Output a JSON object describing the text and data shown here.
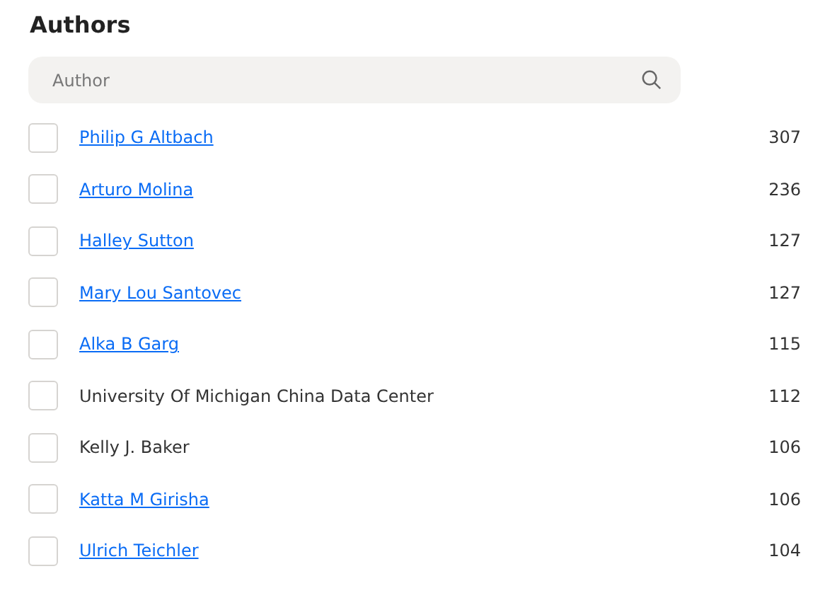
{
  "title": "Authors",
  "search": {
    "placeholder": "Author"
  },
  "authors": [
    {
      "name": "Philip G Altbach",
      "kind": "link",
      "count": "307",
      "checked": false
    },
    {
      "name": "Arturo Molina",
      "kind": "link",
      "count": "236",
      "checked": false
    },
    {
      "name": "Halley Sutton",
      "kind": "link",
      "count": "127",
      "checked": false
    },
    {
      "name": "Mary Lou Santovec",
      "kind": "link",
      "count": "127",
      "checked": false
    },
    {
      "name": "Alka B Garg",
      "kind": "link",
      "count": "115",
      "checked": false
    },
    {
      "name": "University Of Michigan China Data Center",
      "kind": "text",
      "count": "112",
      "checked": false
    },
    {
      "name": "Kelly J. Baker",
      "kind": "text",
      "count": "106",
      "checked": false
    },
    {
      "name": "Katta M Girisha",
      "kind": "link",
      "count": "106",
      "checked": false
    },
    {
      "name": "Ulrich Teichler",
      "kind": "link",
      "count": "104",
      "checked": false
    }
  ]
}
